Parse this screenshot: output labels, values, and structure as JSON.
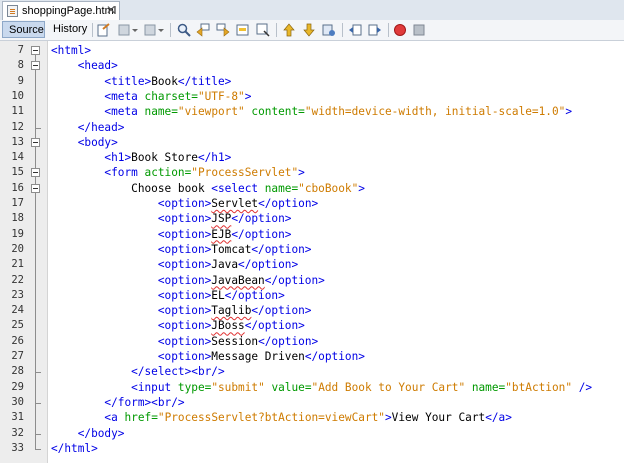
{
  "tab": {
    "filename": "shoppingPage.html",
    "close_glyph": "✕"
  },
  "toolbar": {
    "source_label": "Source",
    "history_label": "History",
    "icons": [
      "last-edit-icon",
      "back-icon",
      "forward-icon",
      "find-icon",
      "find-previous-icon",
      "find-next-icon",
      "toggle-highlight-icon",
      "toggle-rectangular-selection-icon",
      "previous-bookmark-icon",
      "next-bookmark-icon",
      "toggle-bookmark-icon",
      "shift-left-icon",
      "shift-right-icon",
      "start-macro-icon",
      "stop-macro-icon"
    ]
  },
  "editor": {
    "line_numbers": [
      "7",
      "8",
      "9",
      "10",
      "11",
      "12",
      "13",
      "14",
      "15",
      "16",
      "17",
      "18",
      "19",
      "20",
      "21",
      "22",
      "23",
      "24",
      "25",
      "26",
      "27",
      "28",
      "29",
      "30",
      "31",
      "32",
      "33"
    ],
    "lines": [
      [
        [
          "tag",
          "<html>"
        ]
      ],
      [
        [
          "tag",
          "    <head>"
        ]
      ],
      [
        [
          "tag",
          "        <title>"
        ],
        [
          "txt",
          "Book"
        ],
        [
          "tag",
          "</title>"
        ]
      ],
      [
        [
          "tag",
          "        <meta "
        ],
        [
          "attr",
          "charset="
        ],
        [
          "val",
          "\"UTF-8\""
        ],
        [
          "tag",
          ">"
        ]
      ],
      [
        [
          "tag",
          "        <meta "
        ],
        [
          "attr",
          "name="
        ],
        [
          "val",
          "\"viewport\""
        ],
        [
          "txt",
          " "
        ],
        [
          "attr",
          "content="
        ],
        [
          "val",
          "\"width=device-width, initial-scale=1.0\""
        ],
        [
          "tag",
          ">"
        ]
      ],
      [
        [
          "tag",
          "    </head>"
        ]
      ],
      [
        [
          "tag",
          "    <body>"
        ]
      ],
      [
        [
          "tag",
          "        <h1>"
        ],
        [
          "txt",
          "Book Store"
        ],
        [
          "tag",
          "</h1>"
        ]
      ],
      [
        [
          "tag",
          "        <form "
        ],
        [
          "attr",
          "action="
        ],
        [
          "val",
          "\"ProcessServlet\""
        ],
        [
          "tag",
          ">"
        ]
      ],
      [
        [
          "txt",
          "            Choose book "
        ],
        [
          "tag",
          "<select "
        ],
        [
          "attr",
          "name="
        ],
        [
          "val",
          "\"cboBook\""
        ],
        [
          "tag",
          ">"
        ]
      ],
      [
        [
          "tag",
          "                <option>"
        ],
        [
          "sq",
          "Servlet"
        ],
        [
          "tag",
          "</option>"
        ]
      ],
      [
        [
          "tag",
          "                <option>"
        ],
        [
          "sq",
          "JSP"
        ],
        [
          "tag",
          "</option>"
        ]
      ],
      [
        [
          "tag",
          "                <option>"
        ],
        [
          "sq",
          "EJB"
        ],
        [
          "tag",
          "</option>"
        ]
      ],
      [
        [
          "tag",
          "                <option>"
        ],
        [
          "txt",
          "Tomcat"
        ],
        [
          "tag",
          "</option>"
        ]
      ],
      [
        [
          "tag",
          "                <option>"
        ],
        [
          "txt",
          "Java"
        ],
        [
          "tag",
          "</option>"
        ]
      ],
      [
        [
          "tag",
          "                <option>"
        ],
        [
          "sq",
          "JavaBean"
        ],
        [
          "tag",
          "</option>"
        ]
      ],
      [
        [
          "tag",
          "                <option>"
        ],
        [
          "txt",
          "EL"
        ],
        [
          "tag",
          "</option>"
        ]
      ],
      [
        [
          "tag",
          "                <option>"
        ],
        [
          "sq",
          "Taglib"
        ],
        [
          "tag",
          "</option>"
        ]
      ],
      [
        [
          "tag",
          "                <option>"
        ],
        [
          "sq",
          "JBoss"
        ],
        [
          "tag",
          "</option>"
        ]
      ],
      [
        [
          "tag",
          "                <option>"
        ],
        [
          "txt",
          "Session"
        ],
        [
          "tag",
          "</option>"
        ]
      ],
      [
        [
          "tag",
          "                <option>"
        ],
        [
          "txt",
          "Message Driven"
        ],
        [
          "tag",
          "</option>"
        ]
      ],
      [
        [
          "tag",
          "            </select><br/>"
        ]
      ],
      [
        [
          "tag",
          "            <input "
        ],
        [
          "attr",
          "type="
        ],
        [
          "val",
          "\"submit\""
        ],
        [
          "txt",
          " "
        ],
        [
          "attr",
          "value="
        ],
        [
          "val",
          "\"Add Book to Your Cart\""
        ],
        [
          "txt",
          " "
        ],
        [
          "attr",
          "name="
        ],
        [
          "val",
          "\"btAction\""
        ],
        [
          "tag",
          " />"
        ]
      ],
      [
        [
          "tag",
          "        </form><br/>"
        ]
      ],
      [
        [
          "tag",
          "        <a "
        ],
        [
          "attr",
          "href="
        ],
        [
          "val",
          "\"ProcessServlet?btAction=viewCart\""
        ],
        [
          "tag",
          ">"
        ],
        [
          "txt",
          "View Your Cart"
        ],
        [
          "tag",
          "</a>"
        ]
      ],
      [
        [
          "tag",
          "    </body>"
        ]
      ],
      [
        [
          "tag",
          "</html>"
        ]
      ]
    ]
  }
}
